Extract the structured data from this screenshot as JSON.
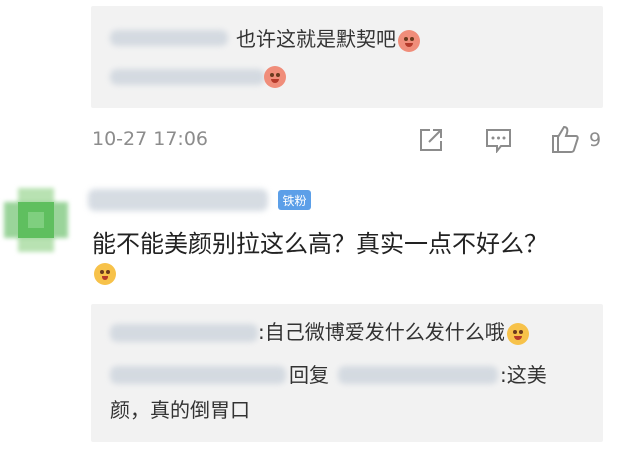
{
  "thread_top": {
    "reply_1_text": "也许这就是默契吧",
    "reply_1_emoji": "laughing-emoji",
    "reply_2_emoji": "laughing-emoji"
  },
  "comment_meta": {
    "timestamp": "10-27 17:06",
    "like_count": "9"
  },
  "comment": {
    "badge": "铁粉",
    "text": "能不能美颜别拉这么高？真实一点不好么？",
    "emoji": "thinking-emoji"
  },
  "replies": {
    "reply_1_sep": ":",
    "reply_1_text": "自己微博爱发什么发什么哦",
    "reply_1_emoji": "laughing-tears-emoji",
    "reply_2_prefix": "回复",
    "reply_2_sep": ":",
    "reply_2_text_a": "这美",
    "reply_2_text_b": "颜，真的倒胃口"
  },
  "icons": [
    "share-icon",
    "comment-icon",
    "like-icon"
  ]
}
